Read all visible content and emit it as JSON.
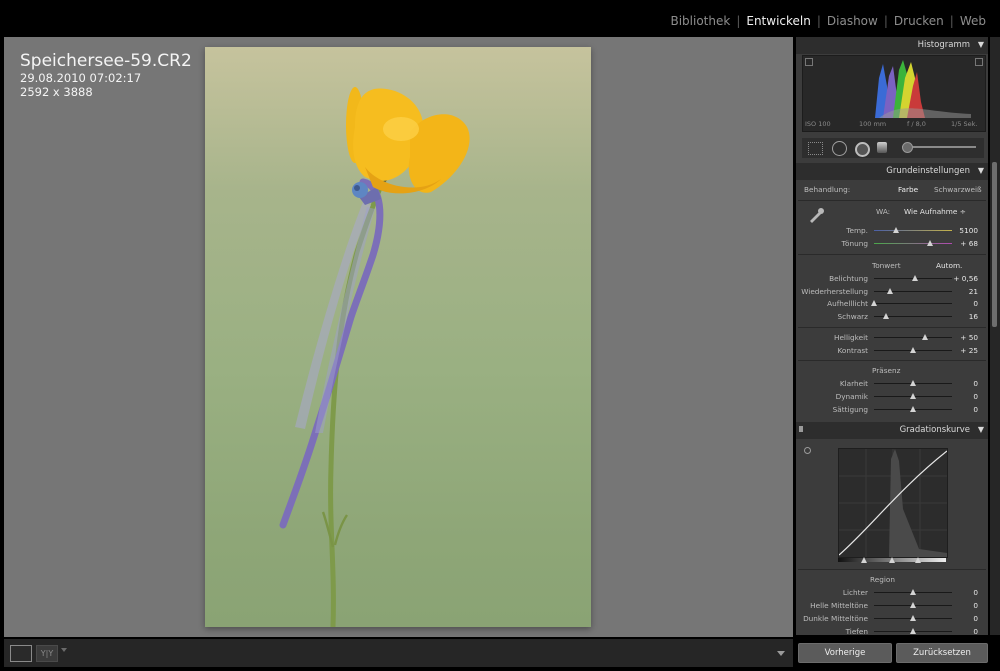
{
  "modules": {
    "items": [
      "Bibliothek",
      "Entwickeln",
      "Diashow",
      "Drucken",
      "Web"
    ],
    "active": "Entwickeln"
  },
  "image_info": {
    "filename": "Speichersee-59.CR2",
    "datetime": "29.08.2010 07:02:17",
    "dimensions": "2592 x 3888"
  },
  "histogram": {
    "title": "Histogramm",
    "iso": "ISO 100",
    "focal": "100 mm",
    "aperture": "f / 8,0",
    "shutter": "1/5 Sek."
  },
  "basic": {
    "title": "Grundeinstellungen",
    "treatment_label": "Behandlung:",
    "treatment_color": "Farbe",
    "treatment_bw": "Schwarzweiß",
    "wb_label": "WA:",
    "wb_value": "Wie Aufnahme ÷",
    "temp": {
      "label": "Temp.",
      "value": "5100",
      "level": 0.28
    },
    "tint": {
      "label": "Tönung",
      "value": "+ 68",
      "level": 0.72
    },
    "tone_label": "Tonwert",
    "auto_label": "Autom.",
    "tone": [
      {
        "label": "Belichtung",
        "value": "+ 0,56",
        "level": 0.53
      },
      {
        "label": "Wiederherstellung",
        "value": "21",
        "level": 0.21
      },
      {
        "label": "Aufhelllicht",
        "value": "0",
        "level": 0.0
      },
      {
        "label": "Schwarz",
        "value": "16",
        "level": 0.16
      }
    ],
    "brightness": [
      {
        "label": "Helligkeit",
        "value": "+ 50",
        "level": 0.66
      },
      {
        "label": "Kontrast",
        "value": "+ 25",
        "level": 0.5
      }
    ],
    "presence_label": "Präsenz",
    "presence": [
      {
        "label": "Klarheit",
        "value": "0",
        "level": 0.5
      },
      {
        "label": "Dynamik",
        "value": "0",
        "level": 0.5
      },
      {
        "label": "Sättigung",
        "value": "0",
        "level": 0.5
      }
    ]
  },
  "curve": {
    "title": "Gradationskurve",
    "region_label": "Region",
    "regions": [
      {
        "label": "Lichter",
        "value": "0",
        "level": 0.5
      },
      {
        "label": "Helle Mitteltöne",
        "value": "0",
        "level": 0.5
      },
      {
        "label": "Dunkle Mitteltöne",
        "value": "0",
        "level": 0.5
      },
      {
        "label": "Tiefen",
        "value": "0",
        "level": 0.5
      }
    ]
  },
  "buttons": {
    "previous": "Vorherige",
    "reset": "Zurücksetzen"
  },
  "colors": {
    "background": "#767676",
    "panel": "#3c3c3c",
    "panel_header": "#2d2d2d",
    "active_module": "#f0f0f0"
  }
}
